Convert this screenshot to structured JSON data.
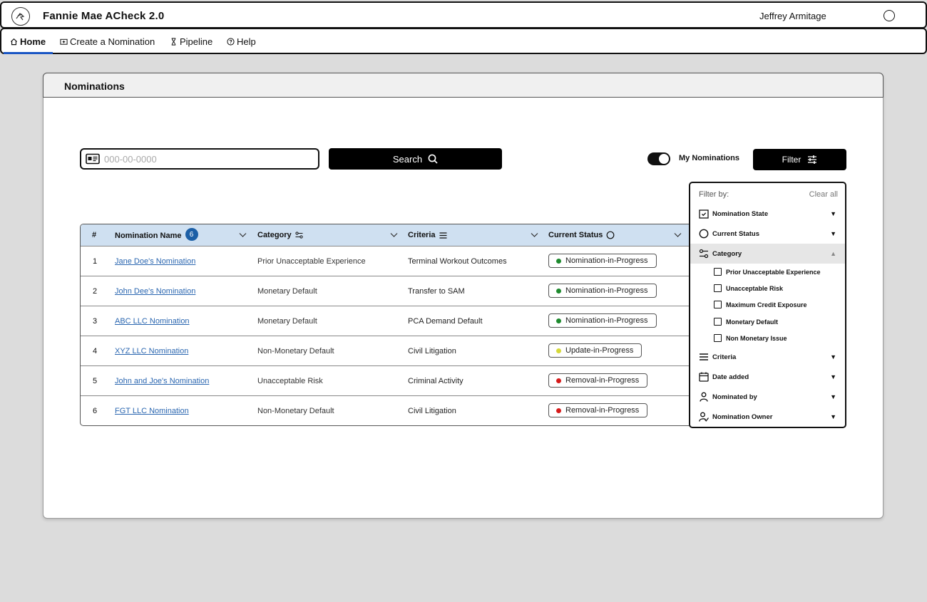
{
  "app": {
    "title": "Fannie Mae ACheck 2.0",
    "user": "Jeffrey Armitage"
  },
  "nav": [
    {
      "label": "Home",
      "icon": "home-icon"
    },
    {
      "label": "Create a Nomination",
      "icon": "create-icon"
    },
    {
      "label": "Pipeline",
      "icon": "hourglass-icon"
    },
    {
      "label": "Help",
      "icon": "help-icon"
    }
  ],
  "panel": {
    "title": "Nominations"
  },
  "search": {
    "placeholder": "000-00-0000",
    "button_label": "Search"
  },
  "toggle": {
    "label": "My Nominations",
    "on": true
  },
  "filter_button": {
    "label": "Filter"
  },
  "table": {
    "headers": {
      "num": "#",
      "name": "Nomination Name",
      "count": "6",
      "category": "Category",
      "criteria": "Criteria",
      "status": "Current Status"
    },
    "rows": [
      {
        "num": "1",
        "name": "Jane Doe's Nomination",
        "category": "Prior Unacceptable Experience",
        "criteria": "Terminal Workout Outcomes",
        "status": "Nomination-in-Progress",
        "status_color": "#1e8a2e"
      },
      {
        "num": "2",
        "name": "John Dee's Nomination",
        "category": "Monetary Default",
        "criteria": "Transfer to SAM",
        "status": "Nomination-in-Progress",
        "status_color": "#1e8a2e"
      },
      {
        "num": "3",
        "name": "ABC LLC Nomination",
        "category": "Monetary Default",
        "criteria": "PCA Demand Default",
        "status": "Nomination-in-Progress",
        "status_color": "#1e8a2e"
      },
      {
        "num": "4",
        "name": "XYZ LLC Nomination",
        "category": "Non-Monetary Default",
        "criteria": "Civil Litigation",
        "status": "Update-in-Progress",
        "status_color": "#d6d93a"
      },
      {
        "num": "5",
        "name": "John and Joe's Nomination",
        "category": "Unacceptable Risk",
        "criteria": "Criminal Activity",
        "status": "Removal-in-Progress",
        "status_color": "#d61a1a"
      },
      {
        "num": "6",
        "name": "FGT LLC Nomination",
        "category": "Non-Monetary Default",
        "criteria": "Civil Litigation",
        "status": "Removal-in-Progress",
        "status_color": "#d61a1a"
      }
    ]
  },
  "filter_panel": {
    "title": "Filter by:",
    "clear_label": "Clear all",
    "groups": [
      {
        "label": "Nomination State",
        "icon": "calendar-check-icon",
        "expanded": false
      },
      {
        "label": "Current Status",
        "icon": "circle-icon",
        "expanded": false
      },
      {
        "label": "Category",
        "icon": "sliders-icon",
        "expanded": true
      },
      {
        "label": "Criteria",
        "icon": "list-icon",
        "expanded": false
      },
      {
        "label": "Date added",
        "icon": "calendar-icon",
        "expanded": false
      },
      {
        "label": "Nominated by",
        "icon": "person-icon",
        "expanded": false
      },
      {
        "label": "Nomination Owner",
        "icon": "person-check-icon",
        "expanded": false
      }
    ],
    "category_options": [
      "Prior Unacceptable Experience",
      "Unacceptable Risk",
      "Maximum Credit Exposure",
      "Monetary Default",
      "Non Monetary Issue"
    ]
  }
}
